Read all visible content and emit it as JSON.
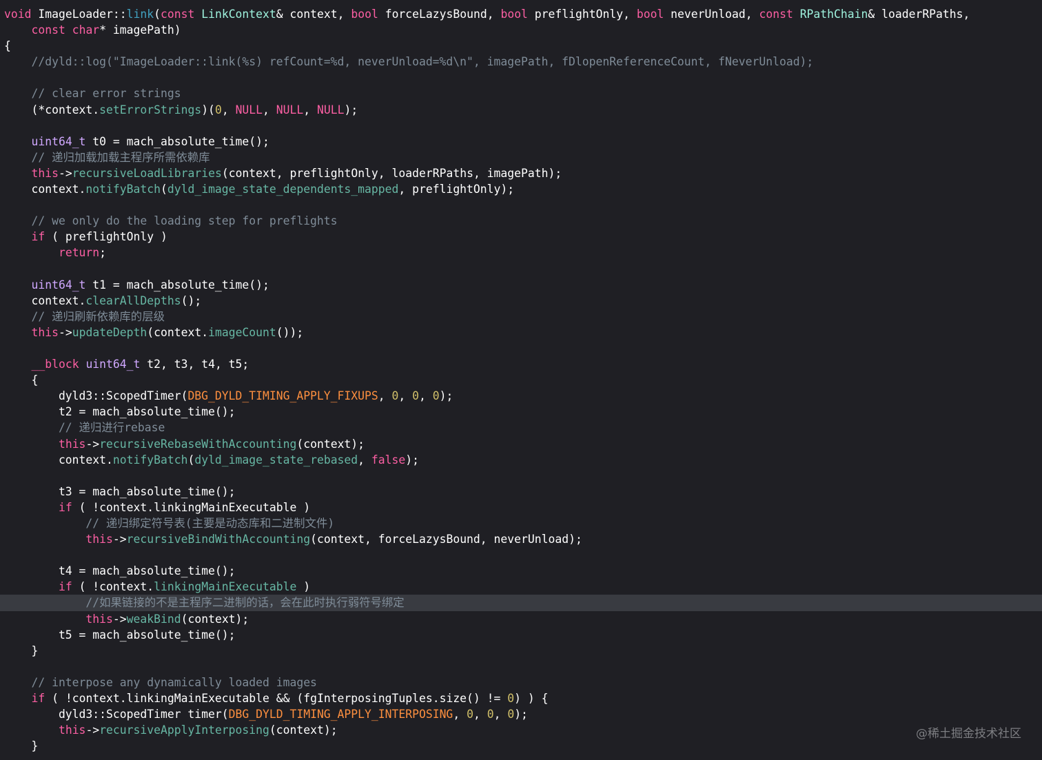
{
  "colors": {
    "background": "#1f1f24",
    "keyword": "#fc5fa3",
    "project_type": "#9ef1dd",
    "project_function": "#67b7a4",
    "other_type": "#d0a8ff",
    "number": "#d0bf69",
    "macro": "#fd8f3f",
    "comment": "#7f8c98",
    "highlight_line": "#393b41"
  },
  "highlighted_line": 38,
  "watermark": "@稀土掘金技术社区",
  "lines": [
    [
      [
        "void",
        "k"
      ],
      [
        " ImageLoader::",
        "p"
      ],
      [
        "link",
        "dec"
      ],
      [
        "(",
        "p"
      ],
      [
        "const",
        "k"
      ],
      [
        " ",
        "p"
      ],
      [
        "LinkContext",
        "pt"
      ],
      [
        "& context, ",
        "p"
      ],
      [
        "bool",
        "k"
      ],
      [
        " forceLazysBound, ",
        "p"
      ],
      [
        "bool",
        "k"
      ],
      [
        " preflightOnly, ",
        "p"
      ],
      [
        "bool",
        "k"
      ],
      [
        " neverUnload, ",
        "p"
      ],
      [
        "const",
        "k"
      ],
      [
        " ",
        "p"
      ],
      [
        "RPathChain",
        "pt"
      ],
      [
        "& loaderRPaths,",
        "p"
      ]
    ],
    [
      [
        "    ",
        "p"
      ],
      [
        "const",
        "k"
      ],
      [
        " ",
        "p"
      ],
      [
        "char",
        "k"
      ],
      [
        "* imagePath)",
        "p"
      ]
    ],
    [
      [
        "{",
        "p"
      ]
    ],
    [
      [
        "    //dyld::log(\"ImageLoader::link(%s) refCount=%d, neverUnload=%d\\n\", imagePath, fDlopenReferenceCount, fNeverUnload);",
        "c"
      ]
    ],
    [],
    [
      [
        "    // clear error strings",
        "c"
      ]
    ],
    [
      [
        "    (*context.",
        "p"
      ],
      [
        "setErrorStrings",
        "pf"
      ],
      [
        ")(",
        "p"
      ],
      [
        "0",
        "n"
      ],
      [
        ", ",
        "p"
      ],
      [
        "NULL",
        "k"
      ],
      [
        ", ",
        "p"
      ],
      [
        "NULL",
        "k"
      ],
      [
        ", ",
        "p"
      ],
      [
        "NULL",
        "k"
      ],
      [
        ");",
        "p"
      ]
    ],
    [],
    [
      [
        "    ",
        "p"
      ],
      [
        "uint64_t",
        "ot"
      ],
      [
        " t0 = mach_absolute_time();",
        "p"
      ]
    ],
    [
      [
        "    // 递归加载加载主程序所需依赖库",
        "c"
      ]
    ],
    [
      [
        "    ",
        "p"
      ],
      [
        "this",
        "k"
      ],
      [
        "->",
        "p"
      ],
      [
        "recursiveLoadLibraries",
        "pf"
      ],
      [
        "(context, preflightOnly, loaderRPaths, imagePath);",
        "p"
      ]
    ],
    [
      [
        "    context.",
        "p"
      ],
      [
        "notifyBatch",
        "pf"
      ],
      [
        "(",
        "p"
      ],
      [
        "dyld_image_state_dependents_mapped",
        "pf"
      ],
      [
        ", preflightOnly);",
        "p"
      ]
    ],
    [],
    [
      [
        "    // we only do the loading step for preflights",
        "c"
      ]
    ],
    [
      [
        "    ",
        "p"
      ],
      [
        "if",
        "k"
      ],
      [
        " ( preflightOnly )",
        "p"
      ]
    ],
    [
      [
        "        ",
        "p"
      ],
      [
        "return",
        "k"
      ],
      [
        ";",
        "p"
      ]
    ],
    [],
    [
      [
        "    ",
        "p"
      ],
      [
        "uint64_t",
        "ot"
      ],
      [
        " t1 = mach_absolute_time();",
        "p"
      ]
    ],
    [
      [
        "    context.",
        "p"
      ],
      [
        "clearAllDepths",
        "pf"
      ],
      [
        "();",
        "p"
      ]
    ],
    [
      [
        "    // 递归刷新依赖库的层级",
        "c"
      ]
    ],
    [
      [
        "    ",
        "p"
      ],
      [
        "this",
        "k"
      ],
      [
        "->",
        "p"
      ],
      [
        "updateDepth",
        "pf"
      ],
      [
        "(context.",
        "p"
      ],
      [
        "imageCount",
        "pf"
      ],
      [
        "());",
        "p"
      ]
    ],
    [],
    [
      [
        "    ",
        "p"
      ],
      [
        "__block",
        "k"
      ],
      [
        " ",
        "p"
      ],
      [
        "uint64_t",
        "ot"
      ],
      [
        " t2, t3, t4, t5;",
        "p"
      ]
    ],
    [
      [
        "    {",
        "p"
      ]
    ],
    [
      [
        "        dyld3::ScopedTimer(",
        "p"
      ],
      [
        "DBG_DYLD_TIMING_APPLY_FIXUPS",
        "m"
      ],
      [
        ", ",
        "p"
      ],
      [
        "0",
        "n"
      ],
      [
        ", ",
        "p"
      ],
      [
        "0",
        "n"
      ],
      [
        ", ",
        "p"
      ],
      [
        "0",
        "n"
      ],
      [
        ");",
        "p"
      ]
    ],
    [
      [
        "        t2 = mach_absolute_time();",
        "p"
      ]
    ],
    [
      [
        "        // 递归进行rebase",
        "c"
      ]
    ],
    [
      [
        "        ",
        "p"
      ],
      [
        "this",
        "k"
      ],
      [
        "->",
        "p"
      ],
      [
        "recursiveRebaseWithAccounting",
        "pf"
      ],
      [
        "(context);",
        "p"
      ]
    ],
    [
      [
        "        context.",
        "p"
      ],
      [
        "notifyBatch",
        "pf"
      ],
      [
        "(",
        "p"
      ],
      [
        "dyld_image_state_rebased",
        "pf"
      ],
      [
        ", ",
        "p"
      ],
      [
        "false",
        "k"
      ],
      [
        ");",
        "p"
      ]
    ],
    [],
    [
      [
        "        t3 = mach_absolute_time();",
        "p"
      ]
    ],
    [
      [
        "        ",
        "p"
      ],
      [
        "if",
        "k"
      ],
      [
        " ( !context.linkingMainExecutable )",
        "p"
      ]
    ],
    [
      [
        "            // 递归绑定符号表(主要是动态库和二进制文件)",
        "c"
      ]
    ],
    [
      [
        "            ",
        "p"
      ],
      [
        "this",
        "k"
      ],
      [
        "->",
        "p"
      ],
      [
        "recursiveBindWithAccounting",
        "pf"
      ],
      [
        "(context, forceLazysBound, neverUnload);",
        "p"
      ]
    ],
    [],
    [
      [
        "        t4 = mach_absolute_time();",
        "p"
      ]
    ],
    [
      [
        "        ",
        "p"
      ],
      [
        "if",
        "k"
      ],
      [
        " ( !context.",
        "p"
      ],
      [
        "linkingMainExecutable",
        "pf"
      ],
      [
        " )",
        "p"
      ]
    ],
    [
      [
        "            //如果链接的不是主程序二进制的话，会在此时执行弱符号绑定",
        "c"
      ]
    ],
    [
      [
        "            ",
        "p"
      ],
      [
        "this",
        "k"
      ],
      [
        "->",
        "p"
      ],
      [
        "weakBind",
        "pf"
      ],
      [
        "(context);",
        "p"
      ]
    ],
    [
      [
        "        t5 = mach_absolute_time();",
        "p"
      ]
    ],
    [
      [
        "    }",
        "p"
      ]
    ],
    [],
    [
      [
        "    // interpose any dynamically loaded images",
        "c"
      ]
    ],
    [
      [
        "    ",
        "p"
      ],
      [
        "if",
        "k"
      ],
      [
        " ( !context.linkingMainExecutable && (fgInterposingTuples.size() != ",
        "p"
      ],
      [
        "0",
        "n"
      ],
      [
        ") ) {",
        "p"
      ]
    ],
    [
      [
        "        dyld3::ScopedTimer timer(",
        "p"
      ],
      [
        "DBG_DYLD_TIMING_APPLY_INTERPOSING",
        "m"
      ],
      [
        ", ",
        "p"
      ],
      [
        "0",
        "n"
      ],
      [
        ", ",
        "p"
      ],
      [
        "0",
        "n"
      ],
      [
        ", ",
        "p"
      ],
      [
        "0",
        "n"
      ],
      [
        ");",
        "p"
      ]
    ],
    [
      [
        "        ",
        "p"
      ],
      [
        "this",
        "k"
      ],
      [
        "->",
        "p"
      ],
      [
        "recursiveApplyInterposing",
        "pf"
      ],
      [
        "(context);",
        "p"
      ]
    ],
    [
      [
        "    }",
        "p"
      ]
    ]
  ]
}
